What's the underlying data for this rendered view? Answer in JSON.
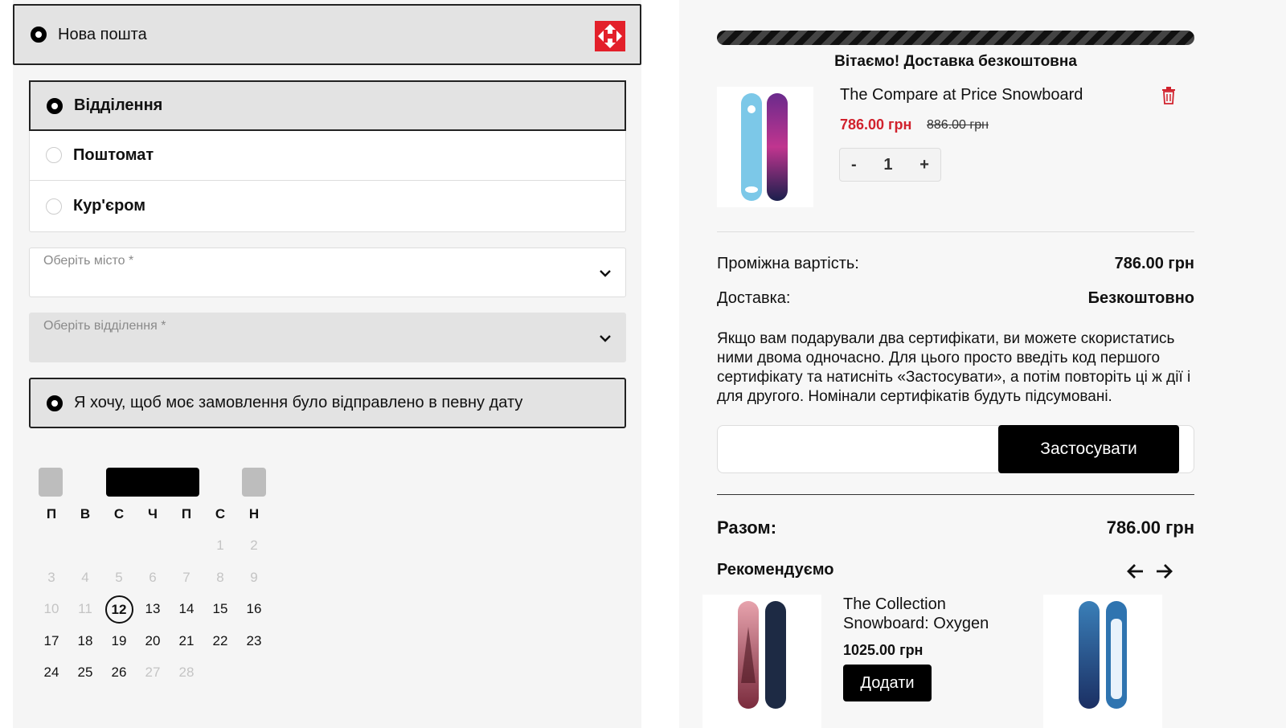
{
  "carrier": {
    "label": "Нова пошта",
    "logo": "nova-poshta-logo",
    "brand_color": "#e3202a"
  },
  "methods": [
    {
      "label": "Відділення",
      "selected": true
    },
    {
      "label": "Поштомат",
      "selected": false
    },
    {
      "label": "Кур'єром",
      "selected": false
    }
  ],
  "city_select": {
    "placeholder": "Оберіть місто *"
  },
  "branch_select": {
    "placeholder": "Оберіть відділення *"
  },
  "date_option": {
    "label": "Я хочу, щоб моє замовлення було відправлено в певну дату"
  },
  "calendar": {
    "weekdays": [
      "П",
      "В",
      "С",
      "Ч",
      "П",
      "С",
      "Н"
    ],
    "weeks": [
      [
        "",
        "",
        "",
        "",
        "",
        "1",
        "2"
      ],
      [
        "3",
        "4",
        "5",
        "6",
        "7",
        "8",
        "9"
      ],
      [
        "10",
        "11",
        "12",
        "13",
        "14",
        "15",
        "16"
      ],
      [
        "17",
        "18",
        "19",
        "20",
        "21",
        "22",
        "23"
      ],
      [
        "24",
        "25",
        "26",
        "27",
        "28",
        "",
        ""
      ]
    ],
    "disabled_days": [
      "1",
      "2",
      "3",
      "4",
      "5",
      "6",
      "7",
      "8",
      "9",
      "10",
      "11",
      "27",
      "28"
    ],
    "today": "12"
  },
  "cart": {
    "free_shipping_message": "Вітаємо! Доставка безкоштовна",
    "item": {
      "title": "The Compare at Price Snowboard",
      "price": "786.00 грн",
      "old_price": "886.00 грн",
      "quantity": "1",
      "minus": "-",
      "plus": "+"
    },
    "subtotal_label": "Проміжна вартість:",
    "subtotal_value": "786.00 грн",
    "shipping_label": "Доставка:",
    "shipping_value": "Безкоштовно",
    "certificate_text": "Якщо вам подарували два сертифікати, ви можете скористатись ними двома одночасно. Для цього просто введіть код першого сертифікату та натисніть «Застосувати», а потім повторіть ці ж дії і для другого. Номінали сертифікатів будуть підсумовані.",
    "apply_label": "Застосувати",
    "total_label": "Разом:",
    "total_value": "786.00 грн"
  },
  "recommended": {
    "title": "Рекомендуємо",
    "items": [
      {
        "name": "The Collection Snowboard: Oxygen",
        "price": "1025.00 грн",
        "add_label": "Додати"
      }
    ]
  },
  "colors": {
    "accent": "#000000",
    "sale_price": "#d1222d",
    "selected_bg": "#e3e3e3"
  }
}
